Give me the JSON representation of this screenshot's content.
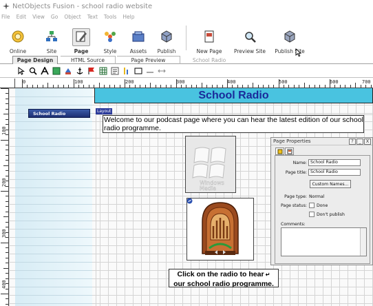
{
  "window": {
    "title": "NetObjects Fusion - school radio website"
  },
  "menu": [
    "File",
    "Edit",
    "View",
    "Go",
    "Object",
    "Text",
    "Tools",
    "Help"
  ],
  "toolbar": {
    "online": "Online",
    "site": "Site",
    "page": "Page",
    "style": "Style",
    "assets": "Assets",
    "publish": "Publish",
    "new_page": "New Page",
    "preview_site": "Preview Site",
    "publish_site": "Publish Site"
  },
  "tabs": {
    "page_design": "Page Design",
    "html_source": "HTML Source",
    "page_preview": "Page Preview",
    "current_page": "School Radio"
  },
  "ruler": {
    "h": [
      "0",
      "100",
      "200",
      "300",
      "400",
      "500",
      "600",
      "700"
    ],
    "v": [
      "100",
      "200",
      "300",
      "400"
    ]
  },
  "page": {
    "banner": "School Radio",
    "nav_item": "School Radio",
    "layout_tag": "Layout",
    "welcome": "Welcome to our podcast page where you can hear the latest edition of our school radio programme.",
    "wm_line1": "Windows",
    "wm_line2": "Media",
    "caption_line1": "Click on the radio to hear",
    "caption_line2": "our school radio programme."
  },
  "properties": {
    "title": "Page Properties",
    "help": "?",
    "min": "_",
    "close": "X",
    "name_label": "Name:",
    "name_value": "School Radio",
    "page_title_label": "Page title:",
    "page_title_value": "School Radio",
    "custom_names": "Custom Names...",
    "page_type_label": "Page type:",
    "page_type_value": "Normal",
    "page_status_label": "Page status:",
    "done": "Done",
    "dont_publish": "Don't publish",
    "comments_label": "Comments:"
  }
}
